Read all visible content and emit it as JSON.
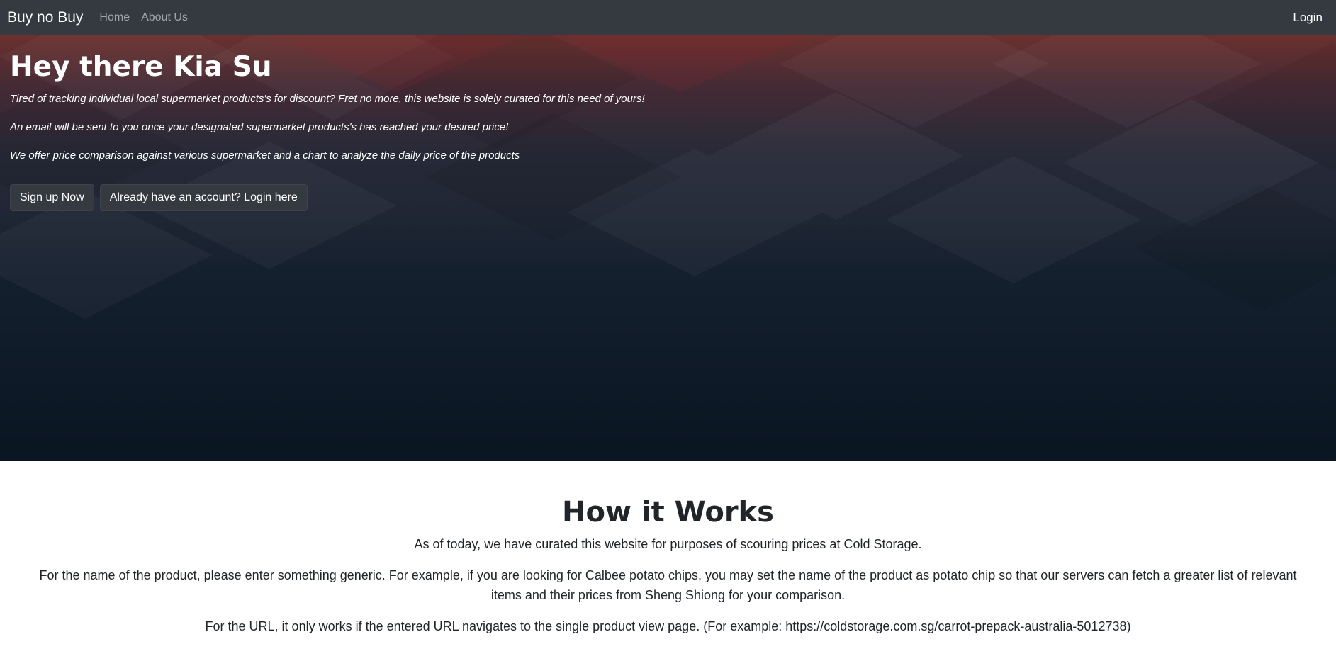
{
  "navbar": {
    "brand": "Buy no Buy",
    "links": [
      "Home",
      "About Us"
    ],
    "login": "Login",
    "background": "#343a40"
  },
  "hero": {
    "title": "Hey there Kia Su",
    "paragraphs": [
      "Tired of tracking individual local supermarket products's for discount? Fret no more, this website is solely curated for this need of yours!",
      "An email will be sent to you once your designated supermarket products's has reached your desired price!",
      "We offer price comparison against various supermarket and a chart to analyze the daily price of the products"
    ],
    "buttons": {
      "signup": "Sign up Now",
      "login": "Already have an account? Login here"
    }
  },
  "how": {
    "title": "How it Works",
    "paragraphs": [
      "As of today, we have curated this website for purposes of scouring prices at Cold Storage.",
      "For the name of the product, please enter something generic. For example, if you are looking for Calbee potato chips, you may set the name of the product as potato chip so that our servers can fetch a greater list of relevant items and their prices from Sheng Shiong for your comparison.",
      "For the URL, it only works if the entered URL navigates to the single product view page. (For example: https://coldstorage.com.sg/carrot-prepack-australia-5012738)"
    ]
  }
}
